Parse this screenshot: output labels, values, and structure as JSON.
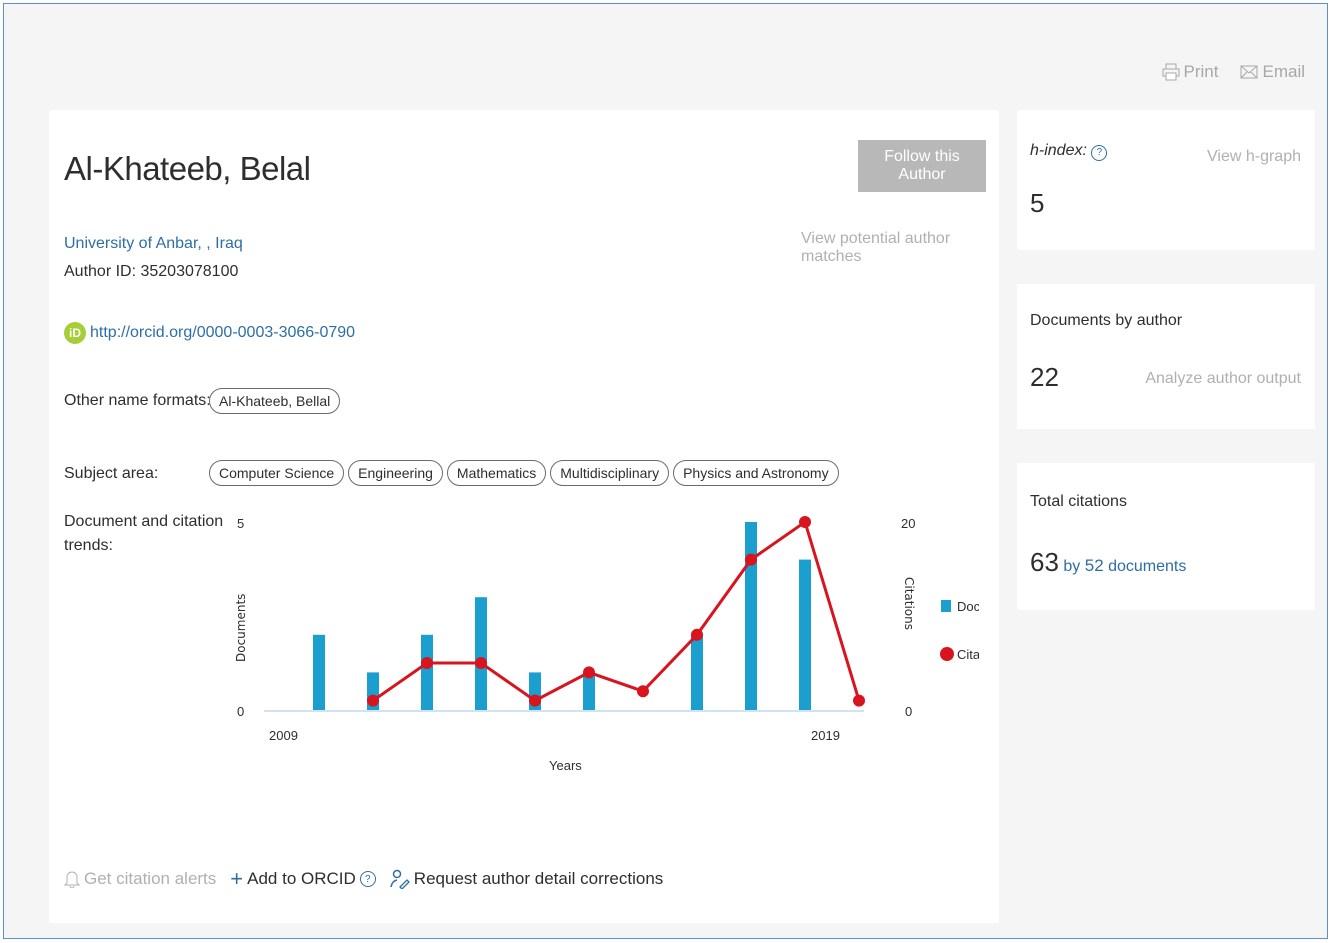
{
  "toolbar": {
    "print_label": "Print",
    "email_label": "Email"
  },
  "author": {
    "name": "Al-Khateeb, Belal",
    "follow_label": "Follow this Author",
    "potential_matches": "View potential author matches",
    "affiliation": "University of Anbar, , Iraq",
    "author_id": "Author ID: 35203078100",
    "orcid_url": "http://orcid.org/0000-0003-3066-0790",
    "other_name_label": "Other name formats:",
    "other_names": [
      "Al-Khateeb, Bellal"
    ],
    "subject_label": "Subject area:",
    "subjects": [
      "Computer Science",
      "Engineering",
      "Mathematics",
      "Multidisciplinary",
      "Physics and Astronomy"
    ],
    "trends_label_1": "Document and citation",
    "trends_label_2": "trends:"
  },
  "chart_data": {
    "type": "bar+line",
    "x": [
      2009,
      2010,
      2011,
      2012,
      2013,
      2014,
      2015,
      2016,
      2017,
      2018,
      2019
    ],
    "series": [
      {
        "name": "Documents",
        "axis": "left",
        "type": "bar",
        "color": "#1a9fcf",
        "values": [
          2,
          1,
          2,
          3,
          1,
          1,
          0,
          2,
          5,
          4,
          0
        ]
      },
      {
        "name": "Citations",
        "axis": "right",
        "type": "line",
        "color": "#d8141f",
        "values": [
          null,
          1,
          5,
          5,
          1,
          4,
          2,
          8,
          16,
          20,
          1
        ]
      }
    ],
    "xlabel": "Years",
    "ylabel_left": "Documents",
    "ylabel_right": "Citations",
    "ylim_left": [
      0,
      5
    ],
    "ylim_right": [
      0,
      20
    ],
    "x_tick_labels": [
      "2009",
      "2019"
    ],
    "y_left_ticks": [
      "5",
      "0"
    ],
    "y_right_ticks": [
      "20",
      "0"
    ],
    "legend_position": "right"
  },
  "actions": {
    "alerts_label": "Get citation alerts",
    "orcid_add_label": "Add to ORCID",
    "corrections_label": "Request author detail corrections"
  },
  "metrics": {
    "hindex_label": "h-index:",
    "hindex_value": "5",
    "hgraph_label": "View h-graph",
    "docs_label": "Documents by author",
    "docs_value": "22",
    "analyze_label": "Analyze author output",
    "citations_label": "Total citations",
    "citations_value": "63",
    "citations_by": "by",
    "citations_docs_count": "52",
    "citations_docs_word": "documents"
  }
}
